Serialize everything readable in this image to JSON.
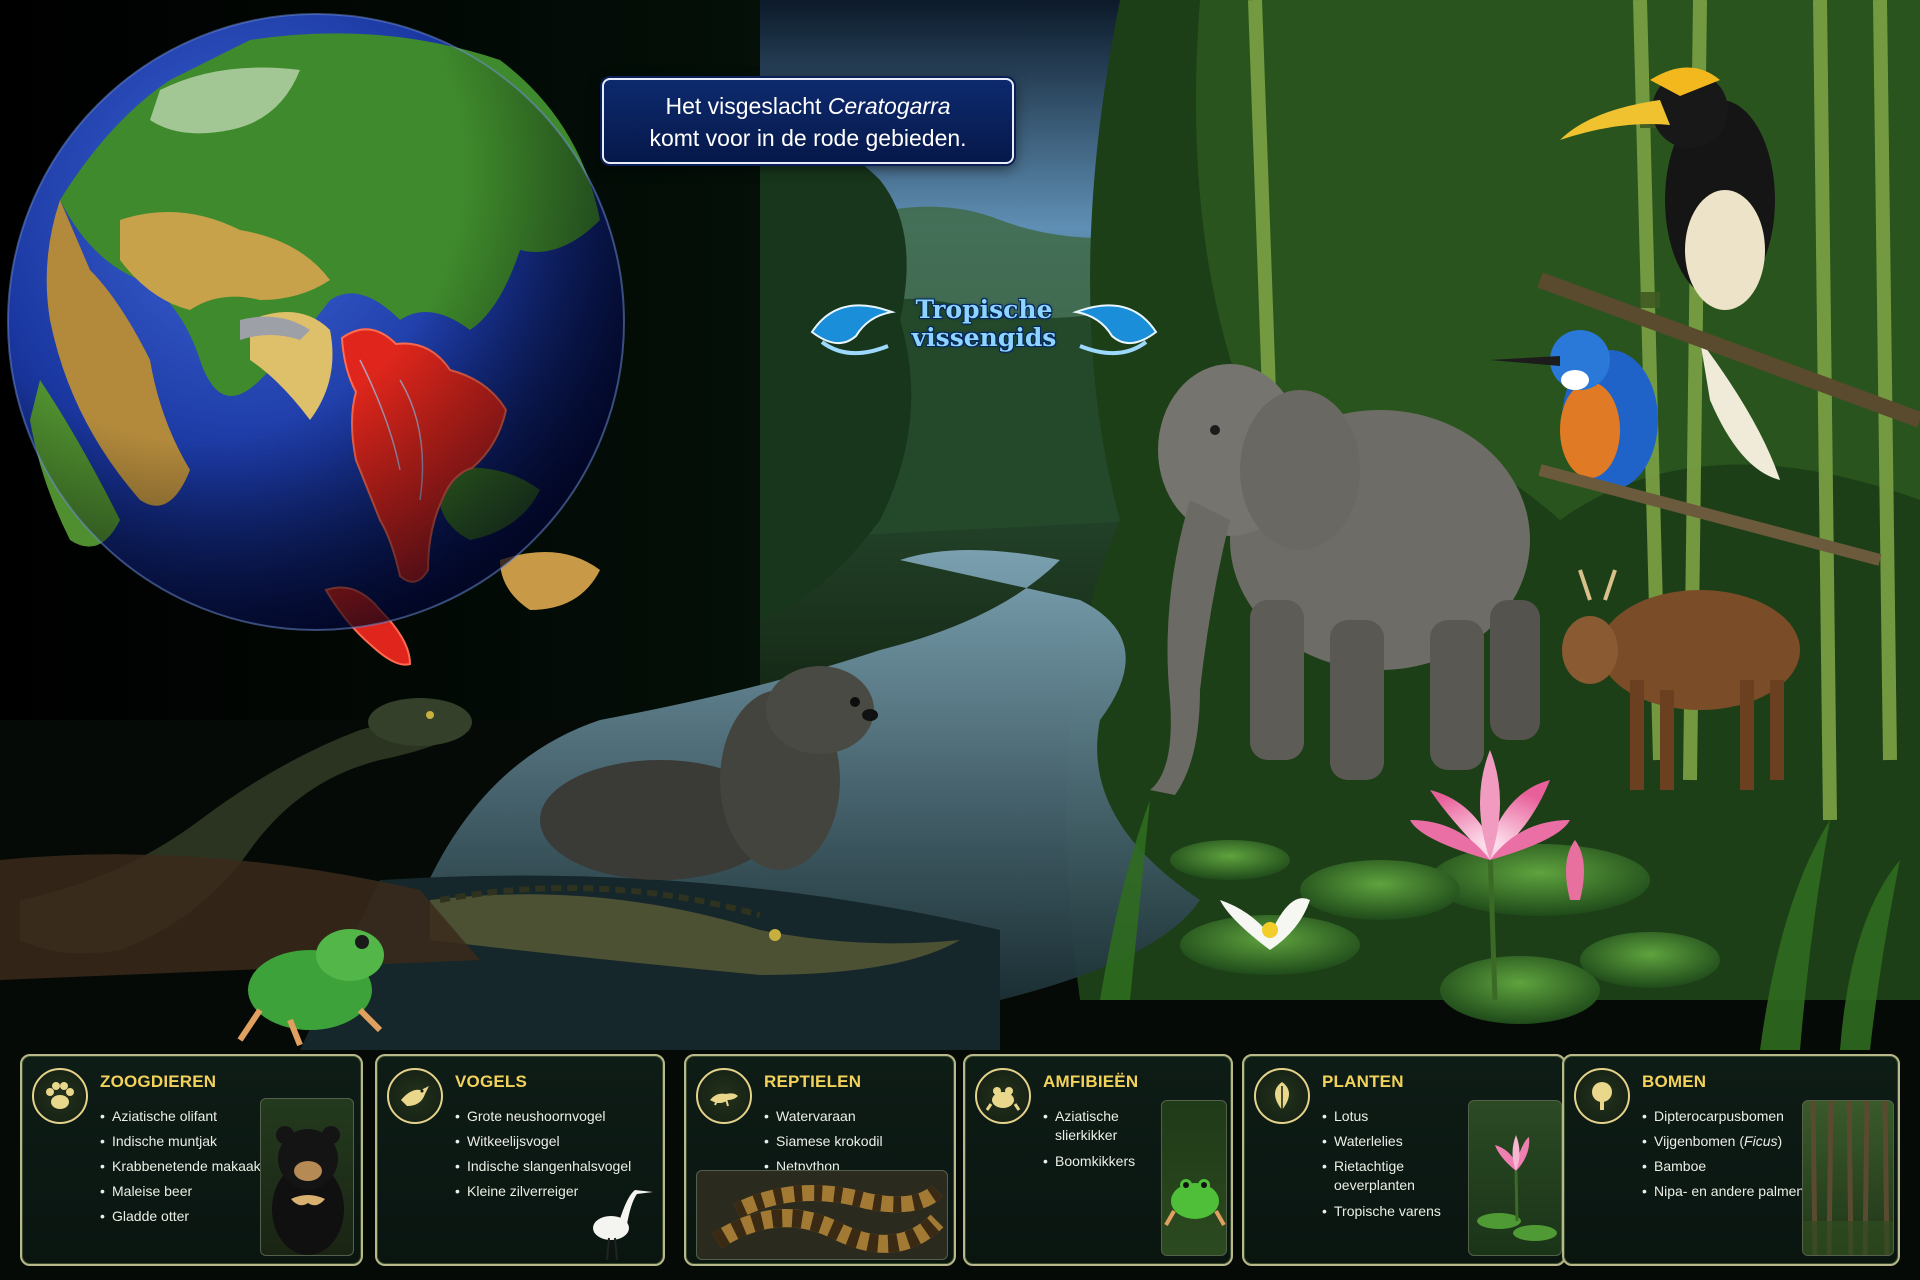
{
  "callout": {
    "line1_prefix": "Het visgeslacht ",
    "line1_genus": "Ceratogarra",
    "line2": "komt voor in de rode gebieden."
  },
  "logo": {
    "line1": "Tropische",
    "line2": "vissengids"
  },
  "panels": [
    {
      "title": "ZOOGDIEREN",
      "icon": "paw-icon",
      "items": [
        "Aziatische olifant",
        "Indische muntjak",
        "Krabbenetende makaak",
        "Maleise beer",
        "Gladde otter"
      ],
      "photo": "sun-bear-photo"
    },
    {
      "title": "VOGELS",
      "icon": "bird-icon",
      "items": [
        "Grote neushoornvogel",
        "Witkeelijsvogel",
        "Indische slangenhalsvogel",
        "Kleine zilverreiger"
      ],
      "photo": "egret-photo"
    },
    {
      "title": "REPTIELEN",
      "icon": "lizard-icon",
      "items": [
        "Watervaraan",
        "Siamese krokodil",
        "Netpython"
      ],
      "photo": "python-photo"
    },
    {
      "title": "AMFIBIEËN",
      "icon": "frog-icon",
      "items": [
        "Aziatische slierkikker",
        "Boomkikkers"
      ],
      "photo": "tree-frog-photo"
    },
    {
      "title": "PLANTEN",
      "icon": "leaf-icon",
      "items": [
        "Lotus",
        "Waterlelies",
        "Rietachtige oeverplanten",
        "Tropische varens"
      ],
      "photo": "lotus-photo"
    },
    {
      "title": "BOMEN",
      "icon": "tree-icon",
      "items_plain": [
        "Dipterocarpusbomen"
      ],
      "ficus_prefix": "Vijgenbomen (",
      "ficus_genus": "Ficus",
      "ficus_suffix": ")",
      "items_after": [
        "Bamboe",
        "Nipa- en andere palmen"
      ],
      "photo": "bamboo-forest-photo"
    }
  ],
  "colors": {
    "panel_title": "#f2d25a",
    "panel_border": "#b7b98a",
    "callout_bg": "#0d2a6e",
    "highlight_region": "#e0261c",
    "ocean": "#1b3aa8"
  }
}
